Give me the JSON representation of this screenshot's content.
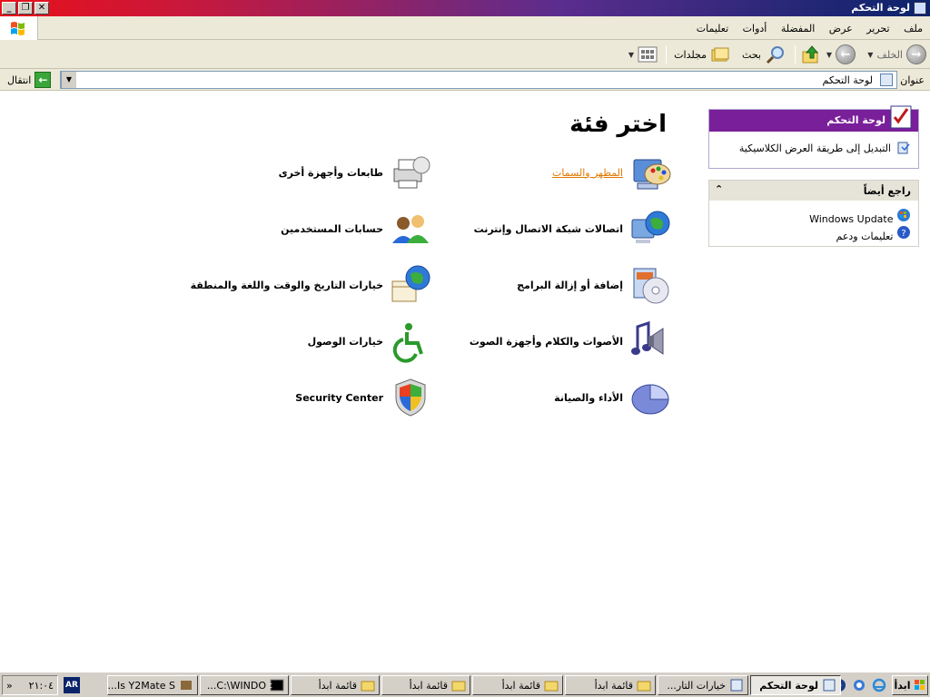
{
  "window": {
    "title": "لوحة التحكم"
  },
  "menu": [
    "ملف",
    "تحرير",
    "عرض",
    "المفضلة",
    "أدوات",
    "تعليمات"
  ],
  "toolbar": {
    "back_label": "الخلف",
    "search_label": "بحث",
    "folders_label": "مجلدات"
  },
  "address": {
    "label": "عنوان",
    "value": "لوحة التحكم",
    "go_label": "انتقال"
  },
  "main": {
    "heading": "اختر فئة",
    "categories": [
      {
        "label": "المظهر والسمات",
        "icon": "appearance-icon",
        "link": true
      },
      {
        "label": "طابعات وأجهزة أخرى",
        "icon": "printer-icon"
      },
      {
        "label": "اتصالات شبكة الاتصال وإنترنت",
        "icon": "network-icon"
      },
      {
        "label": "حسابات المستخدمين",
        "icon": "users-icon"
      },
      {
        "label": "إضافة أو إزالة البرامج",
        "icon": "add-remove-programs-icon"
      },
      {
        "label": "خيارات التاريخ والوقت واللغة والمنطقة",
        "icon": "date-time-icon"
      },
      {
        "label": "الأصوات والكلام وأجهزة الصوت",
        "icon": "sounds-icon"
      },
      {
        "label": "خيارات الوصول",
        "icon": "accessibility-icon"
      },
      {
        "label": "الأداء والصيانة",
        "icon": "performance-icon"
      },
      {
        "label": "Security Center",
        "icon": "shield-icon"
      }
    ]
  },
  "sidebar": {
    "control_panel_title": "لوحة التحكم",
    "classic_view_link": "التبديل إلى طريقة العرض الكلاسيكية",
    "see_also_title": "راجع أيضاً",
    "see_also_items": [
      "Windows Update",
      "تعليمات ودعم"
    ]
  },
  "taskbar": {
    "start_label": "ابدأ",
    "tasks": [
      "لوحة التحكم",
      "خيارات التار...",
      "قائمة ابدأ",
      "قائمة ابدأ",
      "قائمة ابدأ",
      "قائمة ابدأ",
      "C:\\WINDO...",
      "Is Y2Mate S..."
    ],
    "language": "AR",
    "clock": "٢١:٠٤",
    "tray_expand": "«"
  },
  "colors": {
    "title_gradient_start": "#e8101a",
    "title_gradient_end": "#0a246a",
    "panel_header": "#7a1f9a",
    "link_orange": "#e07800"
  }
}
